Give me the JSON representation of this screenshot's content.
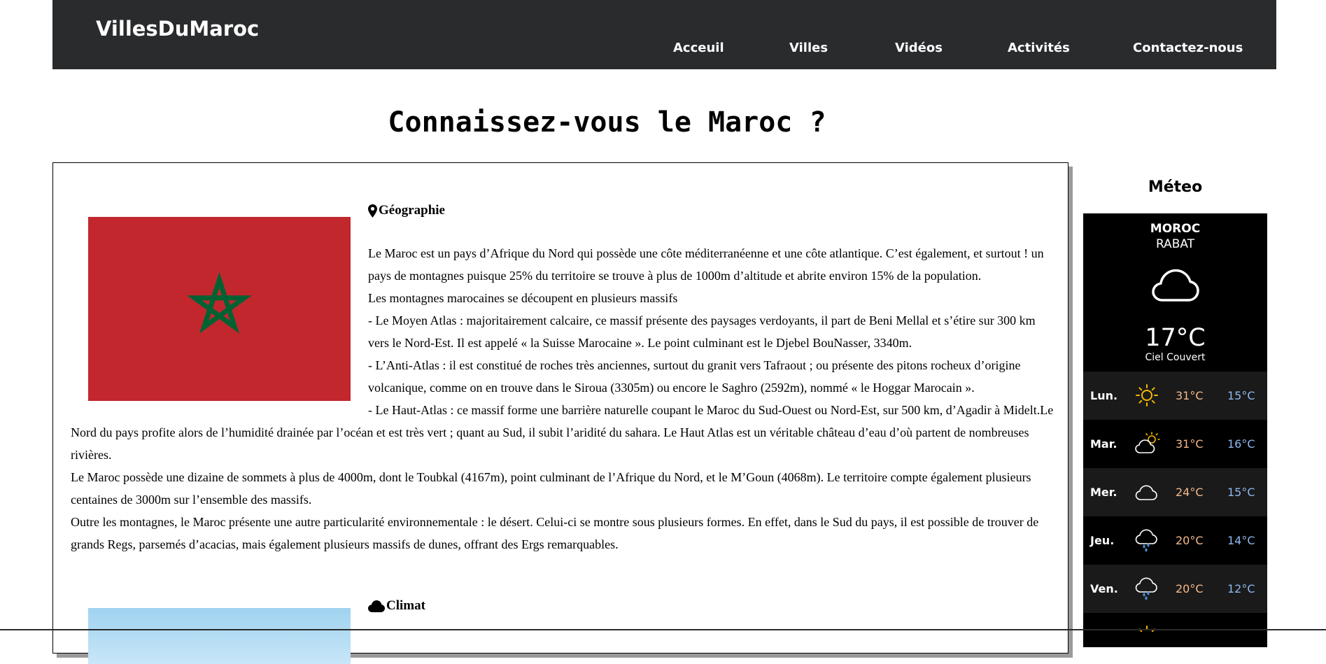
{
  "header": {
    "brand": "VillesDuMaroc",
    "nav": [
      "Acceuil",
      "Villes",
      "Vidéos",
      "Activités",
      "Contactez-nous"
    ]
  },
  "page_title": "Connaissez-vous le Maroc ?",
  "geographie": {
    "title": "Géographie",
    "paragraphs": [
      "Le Maroc est un pays d’Afrique du Nord qui possède une côte méditerranéenne et une côte atlantique. C’est également, et surtout ! un pays de montagnes puisque 25% du territoire se trouve à plus de 1000m d’altitude et abrite environ 15% de la population.",
      "Les montagnes marocaines se découpent en plusieurs massifs",
      "- Le Moyen Atlas : majoritairement calcaire, ce massif présente des paysages verdoyants, il part de Beni Mellal et s’étire sur 300 km vers le Nord-Est. Il est appelé « la Suisse Marocaine ». Le point culminant est le Djebel BouNasser, 3340m.",
      "- L’Anti-Atlas : il est constitué de roches très anciennes, surtout du granit vers Tafraout ; ou présente des pitons rocheux d’origine volcanique, comme on en trouve dans le Siroua (3305m) ou encore le Saghro (2592m), nommé « le Hoggar Marocain ».",
      "- Le Haut-Atlas : ce massif forme une barrière naturelle coupant le Maroc du Sud-Ouest ou Nord-Est, sur 500 km, d’Agadir à Midelt.Le Nord du pays profite alors de l’humidité drainée par l’océan et est très vert ; quant au Sud, il subit l’aridité du sahara. Le Haut Atlas est un véritable château d’eau d’où partent de nombreuses rivières.",
      "Le Maroc possède une dizaine de sommets à plus de 4000m, dont le Toubkal (4167m), point culminant de l’Afrique du Nord, et le M’Goun (4068m). Le territoire compte également plusieurs centaines de 3000m sur l’ensemble des massifs.",
      "Outre les montagnes, le Maroc présente une autre particularité environnementale : le désert. Celui-ci se montre sous plusieurs formes. En effet, dans le Sud du pays, il est possible de trouver de grands Regs, parsemés d’acacias, mais également plusieurs massifs de dunes, offrant des Ergs remarquables."
    ]
  },
  "climat": {
    "title": "Climat"
  },
  "meteo": {
    "title": "Méteo",
    "country": "MOROC",
    "city": "RABAT",
    "temp": "17°C",
    "condition": "Ciel Couvert",
    "forecast": [
      {
        "day": "Lun.",
        "icon": "sun-icon",
        "max": "31°C",
        "min": "15°C"
      },
      {
        "day": "Mar.",
        "icon": "partly-cloudy-icon",
        "max": "31°C",
        "min": "16°C"
      },
      {
        "day": "Mer.",
        "icon": "cloud-icon",
        "max": "24°C",
        "min": "15°C"
      },
      {
        "day": "Jeu.",
        "icon": "rain-icon",
        "max": "20°C",
        "min": "14°C"
      },
      {
        "day": "Ven.",
        "icon": "rain-icon",
        "max": "20°C",
        "min": "12°C"
      }
    ]
  },
  "colors": {
    "header_bg": "#2a2b2d",
    "flag_red": "#c1272d",
    "flag_green": "#006233",
    "sun": "#f5b800",
    "max_temp": "#f6b98a",
    "min_temp": "#8fb8f0"
  }
}
